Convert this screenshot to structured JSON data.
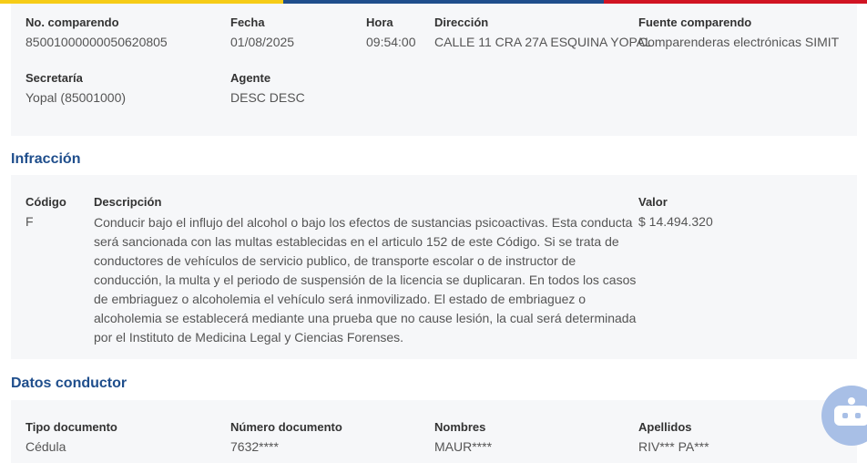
{
  "flag_colors": [
    "#f6cc17",
    "#1f4e8c",
    "#d11423"
  ],
  "comparendo": {
    "no_comparendo": {
      "label": "No. comparendo",
      "value": "85001000000050620805"
    },
    "fecha": {
      "label": "Fecha",
      "value": "01/08/2025"
    },
    "hora": {
      "label": "Hora",
      "value": "09:54:00"
    },
    "direccion": {
      "label": "Dirección",
      "value": "CALLE 11 CRA 27A ESQUINA YOPAL"
    },
    "fuente": {
      "label": "Fuente comparendo",
      "value": "Comparenderas electrónicas SIMIT"
    },
    "secretaria": {
      "label": "Secretaría",
      "value": "Yopal (85001000)"
    },
    "agente": {
      "label": "Agente",
      "value": "DESC DESC"
    }
  },
  "infraccion": {
    "title": "Infracción",
    "codigo": {
      "label": "Código",
      "value": "F"
    },
    "descripcion": {
      "label": "Descripción",
      "value": "Conducir bajo el influjo del alcohol o bajo los efectos de sustancias psicoactivas. Esta conducta será sancionada con las multas establecidas en el articulo 152 de este Código. Si se trata de conductores de vehículos de servicio publico, de transporte escolar o de instructor de conducción, la multa y el periodo de suspensión de la licencia se duplicaran. En todos los casos de embriaguez o alcoholemia el vehículo será inmovilizado. El estado de embriaguez o alcoholemia se establecerá mediante una prueba que no cause lesión, la cual será determinada por el Instituto de Medicina Legal y Ciencias Forenses."
    },
    "valor": {
      "label": "Valor",
      "value": "$ 14.494.320"
    }
  },
  "conductor": {
    "title": "Datos conductor",
    "tipo_documento": {
      "label": "Tipo documento",
      "value": "Cédula"
    },
    "numero_documento": {
      "label": "Número documento",
      "value": "7632****"
    },
    "nombres": {
      "label": "Nombres",
      "value": "MAUR****"
    },
    "apellidos": {
      "label": "Apellidos",
      "value": "RIV*** PA***"
    }
  },
  "chatbot": {
    "icon": "robot-icon"
  }
}
